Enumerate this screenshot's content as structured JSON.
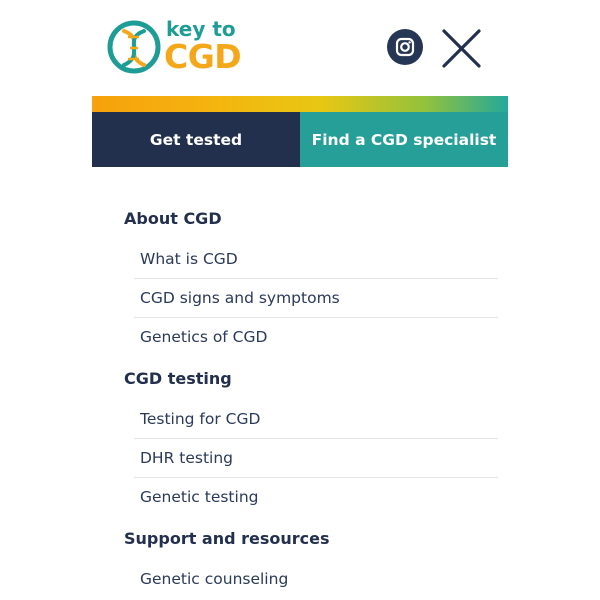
{
  "brand": {
    "logo_top": "key to",
    "logo_bottom": "CGD",
    "colors": {
      "teal": "#1d9d95",
      "orange": "#f5a71a",
      "navy": "#23304d"
    }
  },
  "header": {
    "instagram_icon": "instagram-icon",
    "close_icon": "close-icon"
  },
  "cta": {
    "get_tested": "Get tested",
    "find_specialist": "Find a CGD specialist"
  },
  "menu": {
    "sections": [
      {
        "title": "About CGD",
        "items": [
          "What is CGD",
          "CGD signs and symptoms",
          "Genetics of CGD"
        ]
      },
      {
        "title": "CGD testing",
        "items": [
          "Testing for CGD",
          "DHR testing",
          "Genetic testing"
        ]
      },
      {
        "title": "Support and resources",
        "items": [
          "Genetic counseling"
        ]
      }
    ]
  }
}
